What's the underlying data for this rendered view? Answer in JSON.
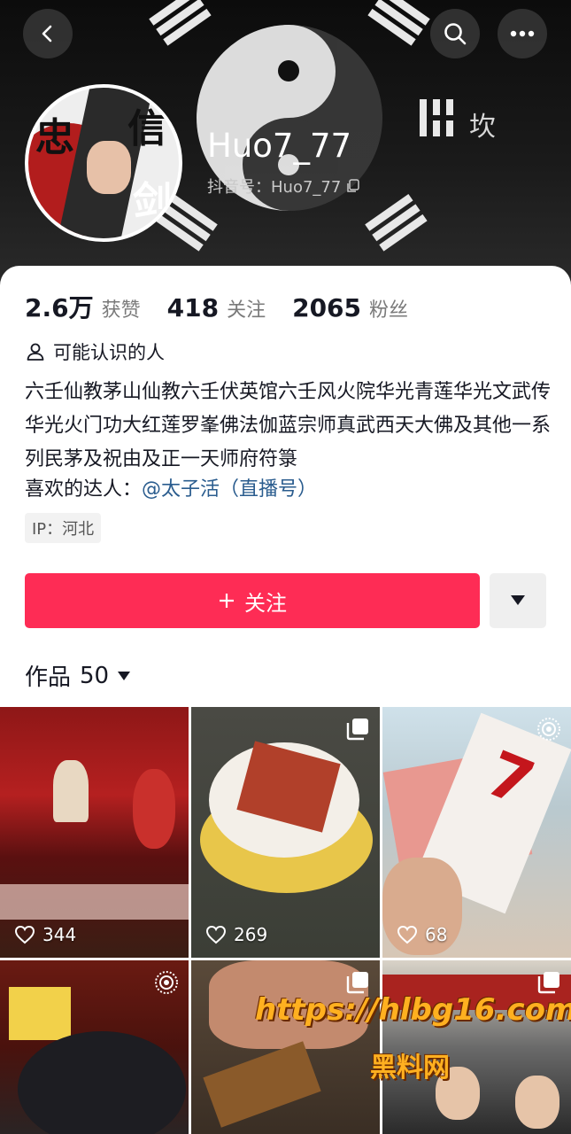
{
  "header": {
    "username": "Huo7_77",
    "douyin_id": "抖音号：Huo7_77",
    "cover_glyph": "坎",
    "back_icon": "chevron-left-icon",
    "search_icon": "search-icon",
    "more_icon": "more-horizontal-icon"
  },
  "stats": [
    {
      "num": "2.6万",
      "label": "获赞"
    },
    {
      "num": "418",
      "label": "关注"
    },
    {
      "num": "2065",
      "label": "粉丝"
    }
  ],
  "maybe_know": "可能认识的人",
  "bio": "六壬仙教茅山仙教六壬伏英馆六壬风火院华光青莲华光文武传华光火门功大红莲罗峯佛法伽蓝宗师真武西天大佛及其他一系列民茅及祝由及正一天师府符箓",
  "likes_prefix": "喜欢的达人：",
  "likes_mention": "@太子活（直播号）",
  "ip": "IP：河北",
  "follow_button": "关注",
  "works": {
    "label": "作品",
    "count": "50"
  },
  "grid": [
    {
      "likes": "344"
    },
    {
      "likes": "269"
    },
    {
      "likes": "68"
    }
  ],
  "watermark": {
    "line1": "https://hlbg16.com",
    "line2": "黑料网"
  },
  "colors": {
    "accent": "#fe2c55",
    "mention": "#2a5c8e",
    "text": "#161823"
  }
}
